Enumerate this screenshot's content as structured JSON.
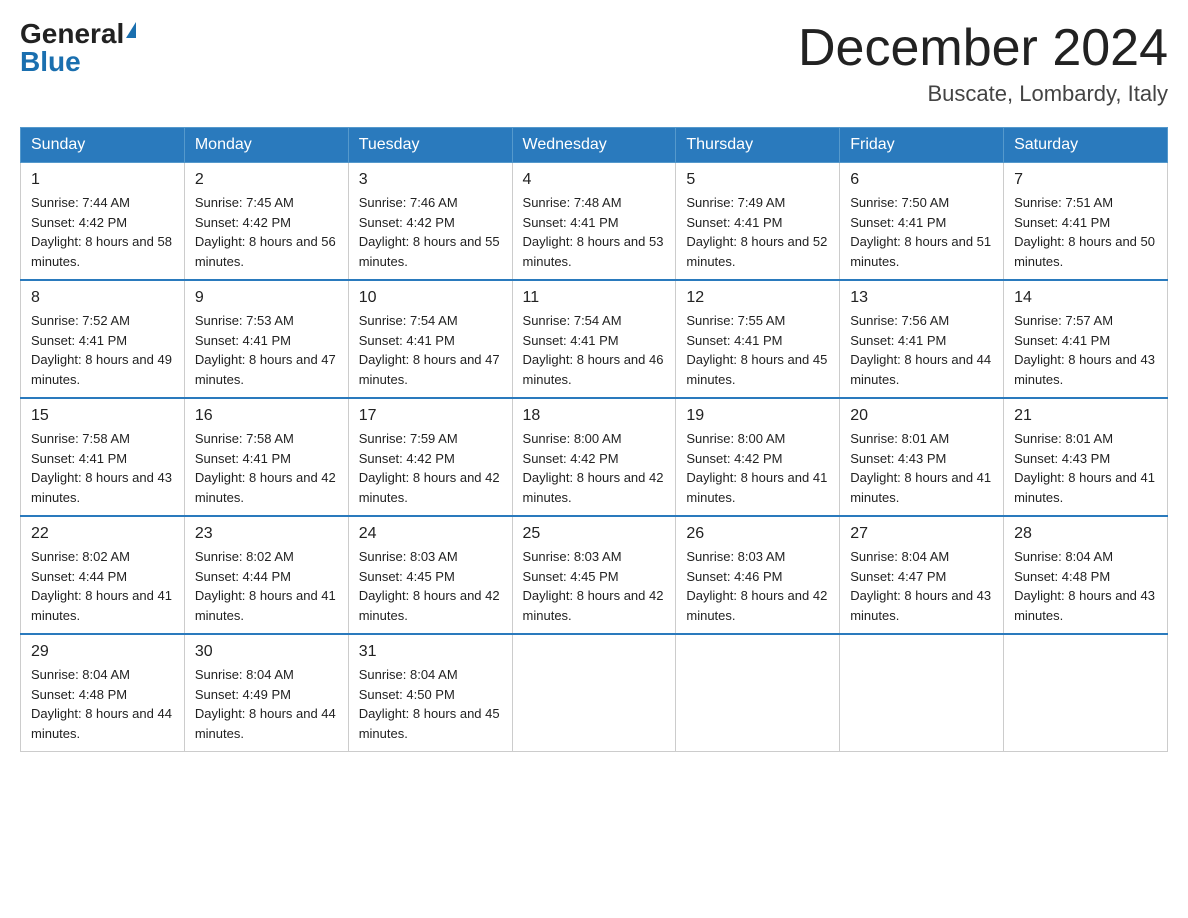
{
  "header": {
    "logo_general": "General",
    "logo_blue": "Blue",
    "month_title": "December 2024",
    "location": "Buscate, Lombardy, Italy"
  },
  "weekdays": [
    "Sunday",
    "Monday",
    "Tuesday",
    "Wednesday",
    "Thursday",
    "Friday",
    "Saturday"
  ],
  "weeks": [
    [
      {
        "day": "1",
        "sunrise": "7:44 AM",
        "sunset": "4:42 PM",
        "daylight": "8 hours and 58 minutes."
      },
      {
        "day": "2",
        "sunrise": "7:45 AM",
        "sunset": "4:42 PM",
        "daylight": "8 hours and 56 minutes."
      },
      {
        "day": "3",
        "sunrise": "7:46 AM",
        "sunset": "4:42 PM",
        "daylight": "8 hours and 55 minutes."
      },
      {
        "day": "4",
        "sunrise": "7:48 AM",
        "sunset": "4:41 PM",
        "daylight": "8 hours and 53 minutes."
      },
      {
        "day": "5",
        "sunrise": "7:49 AM",
        "sunset": "4:41 PM",
        "daylight": "8 hours and 52 minutes."
      },
      {
        "day": "6",
        "sunrise": "7:50 AM",
        "sunset": "4:41 PM",
        "daylight": "8 hours and 51 minutes."
      },
      {
        "day": "7",
        "sunrise": "7:51 AM",
        "sunset": "4:41 PM",
        "daylight": "8 hours and 50 minutes."
      }
    ],
    [
      {
        "day": "8",
        "sunrise": "7:52 AM",
        "sunset": "4:41 PM",
        "daylight": "8 hours and 49 minutes."
      },
      {
        "day": "9",
        "sunrise": "7:53 AM",
        "sunset": "4:41 PM",
        "daylight": "8 hours and 47 minutes."
      },
      {
        "day": "10",
        "sunrise": "7:54 AM",
        "sunset": "4:41 PM",
        "daylight": "8 hours and 47 minutes."
      },
      {
        "day": "11",
        "sunrise": "7:54 AM",
        "sunset": "4:41 PM",
        "daylight": "8 hours and 46 minutes."
      },
      {
        "day": "12",
        "sunrise": "7:55 AM",
        "sunset": "4:41 PM",
        "daylight": "8 hours and 45 minutes."
      },
      {
        "day": "13",
        "sunrise": "7:56 AM",
        "sunset": "4:41 PM",
        "daylight": "8 hours and 44 minutes."
      },
      {
        "day": "14",
        "sunrise": "7:57 AM",
        "sunset": "4:41 PM",
        "daylight": "8 hours and 43 minutes."
      }
    ],
    [
      {
        "day": "15",
        "sunrise": "7:58 AM",
        "sunset": "4:41 PM",
        "daylight": "8 hours and 43 minutes."
      },
      {
        "day": "16",
        "sunrise": "7:58 AM",
        "sunset": "4:41 PM",
        "daylight": "8 hours and 42 minutes."
      },
      {
        "day": "17",
        "sunrise": "7:59 AM",
        "sunset": "4:42 PM",
        "daylight": "8 hours and 42 minutes."
      },
      {
        "day": "18",
        "sunrise": "8:00 AM",
        "sunset": "4:42 PM",
        "daylight": "8 hours and 42 minutes."
      },
      {
        "day": "19",
        "sunrise": "8:00 AM",
        "sunset": "4:42 PM",
        "daylight": "8 hours and 41 minutes."
      },
      {
        "day": "20",
        "sunrise": "8:01 AM",
        "sunset": "4:43 PM",
        "daylight": "8 hours and 41 minutes."
      },
      {
        "day": "21",
        "sunrise": "8:01 AM",
        "sunset": "4:43 PM",
        "daylight": "8 hours and 41 minutes."
      }
    ],
    [
      {
        "day": "22",
        "sunrise": "8:02 AM",
        "sunset": "4:44 PM",
        "daylight": "8 hours and 41 minutes."
      },
      {
        "day": "23",
        "sunrise": "8:02 AM",
        "sunset": "4:44 PM",
        "daylight": "8 hours and 41 minutes."
      },
      {
        "day": "24",
        "sunrise": "8:03 AM",
        "sunset": "4:45 PM",
        "daylight": "8 hours and 42 minutes."
      },
      {
        "day": "25",
        "sunrise": "8:03 AM",
        "sunset": "4:45 PM",
        "daylight": "8 hours and 42 minutes."
      },
      {
        "day": "26",
        "sunrise": "8:03 AM",
        "sunset": "4:46 PM",
        "daylight": "8 hours and 42 minutes."
      },
      {
        "day": "27",
        "sunrise": "8:04 AM",
        "sunset": "4:47 PM",
        "daylight": "8 hours and 43 minutes."
      },
      {
        "day": "28",
        "sunrise": "8:04 AM",
        "sunset": "4:48 PM",
        "daylight": "8 hours and 43 minutes."
      }
    ],
    [
      {
        "day": "29",
        "sunrise": "8:04 AM",
        "sunset": "4:48 PM",
        "daylight": "8 hours and 44 minutes."
      },
      {
        "day": "30",
        "sunrise": "8:04 AM",
        "sunset": "4:49 PM",
        "daylight": "8 hours and 44 minutes."
      },
      {
        "day": "31",
        "sunrise": "8:04 AM",
        "sunset": "4:50 PM",
        "daylight": "8 hours and 45 minutes."
      },
      null,
      null,
      null,
      null
    ]
  ]
}
